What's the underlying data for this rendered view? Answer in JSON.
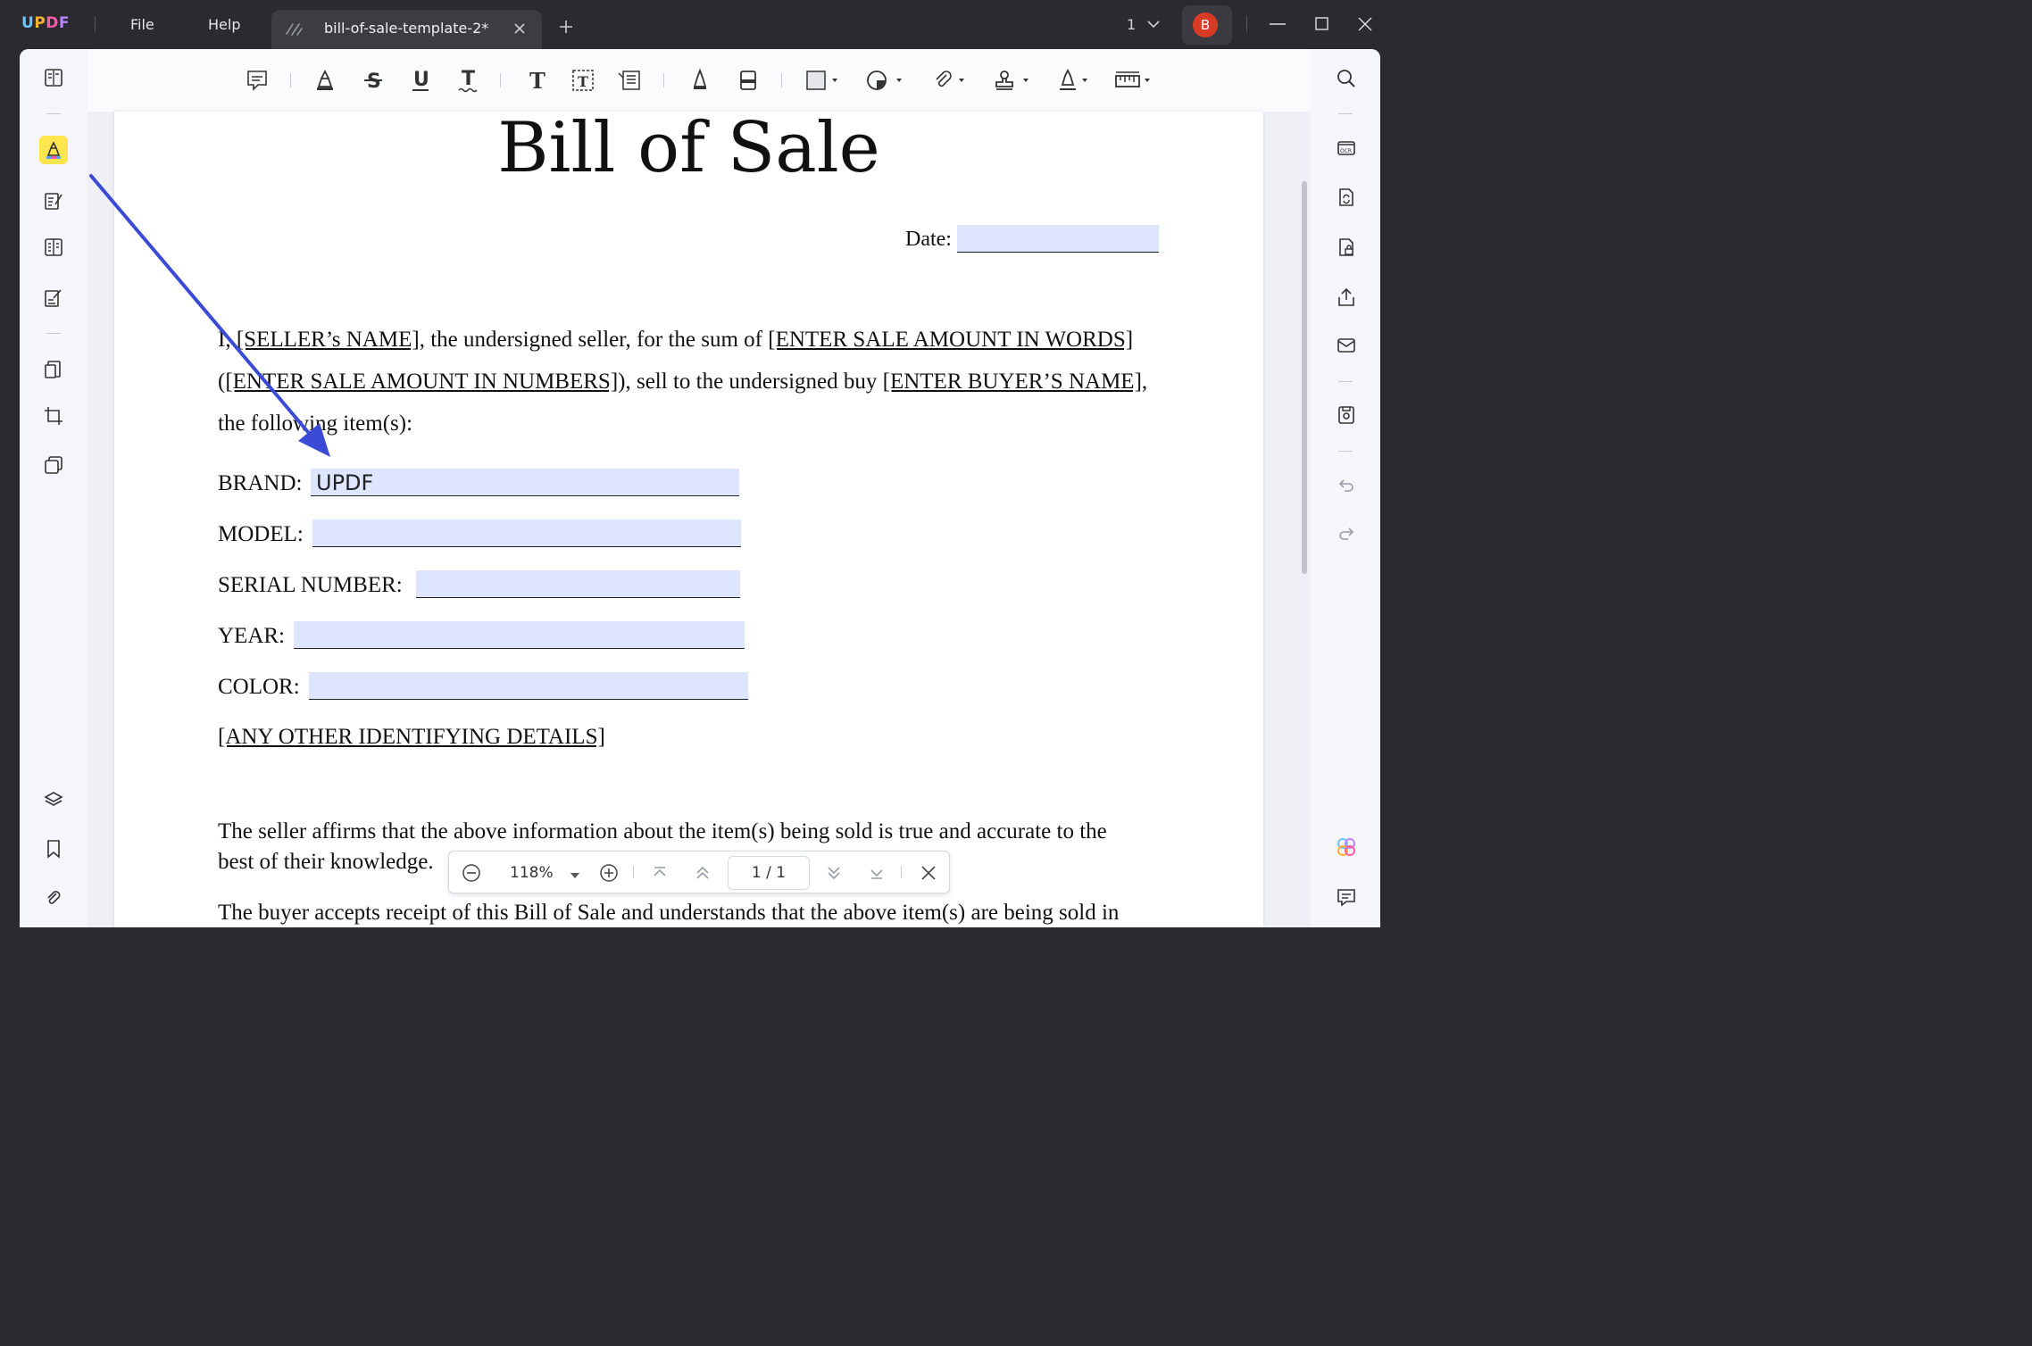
{
  "app": {
    "logo": {
      "u": "U",
      "p": "P",
      "d": "D",
      "f": "F"
    },
    "menu": {
      "file": "File",
      "help": "Help"
    },
    "tab": {
      "title": "bill-of-sale-template-2*"
    },
    "page_selector": "1",
    "user_initial": "B"
  },
  "document": {
    "title": "Bill of Sale",
    "date_label": "Date:",
    "para": {
      "part1": "I, ",
      "seller": "[SELLER’s NAME]",
      "part2": ", the undersigned seller, for the sum of ",
      "amount_words": "[ENTER SALE AMOUNT IN WORDS]",
      "part3": " (",
      "amount_numbers": "[ENTER SALE AMOUNT IN NUMBERS]",
      "part4": "), sell to the undersigned buy ",
      "buyer": "[ENTER BUYER’S NAME]",
      "part5": ", the following item(s):"
    },
    "fields": {
      "brand_label": "BRAND:",
      "brand_value": "UPDF",
      "model_label": "MODEL:",
      "serial_label": "SERIAL NUMBER:",
      "year_label": "YEAR:",
      "color_label": "COLOR:"
    },
    "other_details": "[ANY OTHER IDENTIFYING DETAILS]",
    "seller_statement_line1": "The seller affirms that the above information about the item(s) being sold is true and accurate to the",
    "seller_statement_line2": "best of their knowledge.",
    "buyer_statement": "The buyer accepts receipt of this Bill of Sale and understands that the above item(s) are being sold in"
  },
  "zoom": {
    "level": "118%",
    "page_indicator": "1 / 1"
  },
  "colors": {
    "accent_highlight": "#ffe54d",
    "field_fill": "#dde5ff",
    "annotation_arrow": "#3b4bd6",
    "avatar": "#d93a25"
  }
}
